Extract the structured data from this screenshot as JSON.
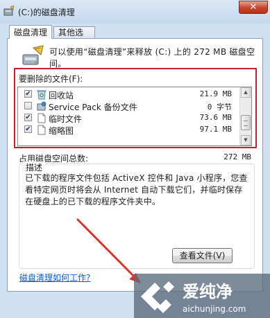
{
  "window": {
    "title": "(C:)的磁盘清理",
    "close_glyph": "✕"
  },
  "tabs": [
    {
      "label": "磁盘清理",
      "active": true
    },
    {
      "label": "其他选项",
      "active": false
    }
  ],
  "info_text": "可以使用“磁盘清理”来释放 (C:) 上的 272 MB 磁盘空间。",
  "files_group_label": "要删除的文件(F):",
  "files": [
    {
      "name": "回收站",
      "size": "21.9 MB",
      "checked": true,
      "icon": "recycle-bin-icon"
    },
    {
      "name": "Service Pack 备份文件",
      "size": "0 字节",
      "checked": false,
      "icon": "service-pack-icon"
    },
    {
      "name": "临时文件",
      "size": "73.6 MB",
      "checked": true,
      "icon": "file-icon"
    },
    {
      "name": "缩略图",
      "size": "97.1 MB",
      "checked": true,
      "icon": "file-icon"
    }
  ],
  "total": {
    "label": "占用磁盘空间总数:",
    "value": "272 MB"
  },
  "description": {
    "label": "描述",
    "text": "已下载的程序文件包括 ActiveX 控件和 Java 小程序，您查看特定网页时将会从 Internet 自动下载它们，并临时保存在硬盘上的已下载的程序文件夹中。"
  },
  "view_files_button": "查看文件(V)",
  "help_link": "磁盘清理如何工作?",
  "watermark": {
    "text": "爱纯净",
    "url": "aichunjing.com"
  },
  "colors": {
    "highlight": "#c8202a",
    "link": "#0a5ad3",
    "panel_border": "#8e9fb5"
  }
}
